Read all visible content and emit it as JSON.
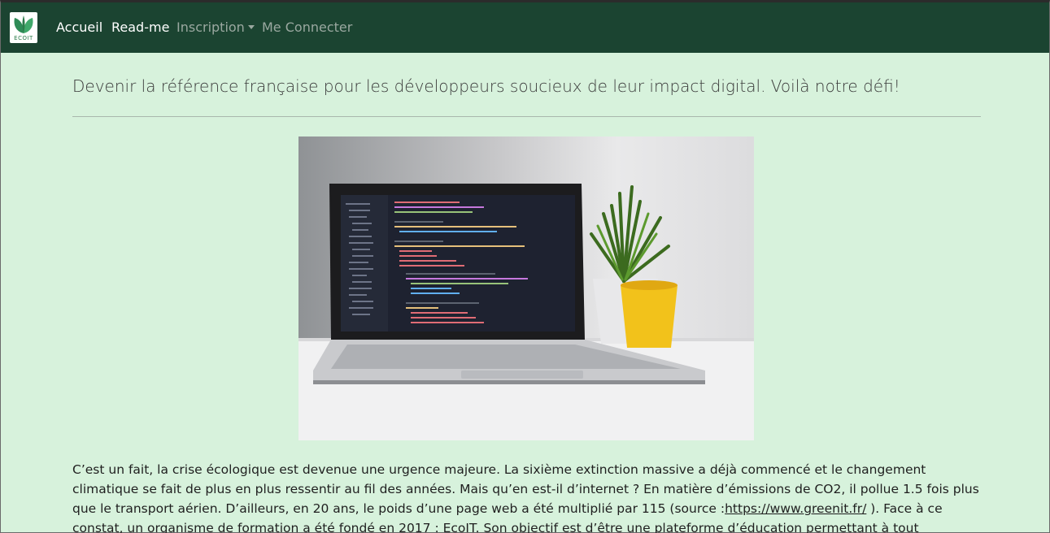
{
  "navbar": {
    "logo_text": "ECOIT",
    "items": [
      {
        "label": "Accueil"
      },
      {
        "label": "Read-me"
      },
      {
        "label": "Inscription"
      },
      {
        "label": "Me Connecter"
      }
    ]
  },
  "main": {
    "lead": "Devenir la référence française pour les développeurs soucieux de leur impact digital. Voilà notre défi!",
    "paragraph_before_link": "C’est un fait, la crise écologique est devenue une urgence majeure. La sixième extinction massive a déjà commencé et le changement climatique se fait de plus en plus ressentir au fil des années. Mais qu’en est-il d’internet ? En matière d’émissions de CO2, il pollue 1.5 fois plus que le transport aérien. D’ailleurs, en 20 ans, le poids d’une page web a été multiplié par 115 (source :",
    "link_text": "https://www.greenit.fr/",
    "paragraph_after_link": " ). Face à ce constat, un organisme de formation a été fondé en 2017 : EcoIT. Son objectif est d’être une plateforme d’éducation permettant à tout instructeur expert en accessibilité et en éco-conception web"
  },
  "colors": {
    "navbar_bg": "#1b4431",
    "page_bg": "#d7f2dc"
  }
}
